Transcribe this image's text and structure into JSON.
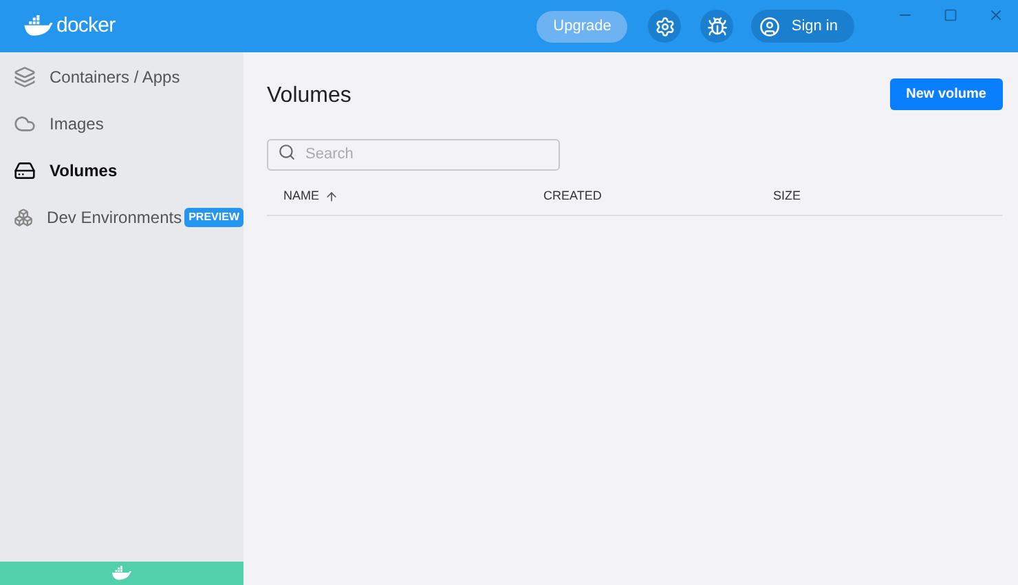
{
  "header": {
    "logo_text": "docker",
    "upgrade": "Upgrade",
    "sign_in": "Sign in"
  },
  "sidebar": {
    "items": [
      {
        "label": "Containers / Apps",
        "kind": "containers",
        "selected": false
      },
      {
        "label": "Images",
        "kind": "images",
        "selected": false
      },
      {
        "label": "Volumes",
        "kind": "volumes",
        "selected": true
      },
      {
        "label": "Dev Environments",
        "kind": "dev",
        "selected": false,
        "badge": "PREVIEW"
      }
    ]
  },
  "main": {
    "title": "Volumes",
    "new_button": "New volume",
    "search": {
      "placeholder": "Search"
    },
    "table": {
      "columns": [
        {
          "label": "NAME",
          "sorted": true
        },
        {
          "label": "CREATED",
          "sorted": false
        },
        {
          "label": "SIZE",
          "sorted": false
        }
      ]
    }
  }
}
